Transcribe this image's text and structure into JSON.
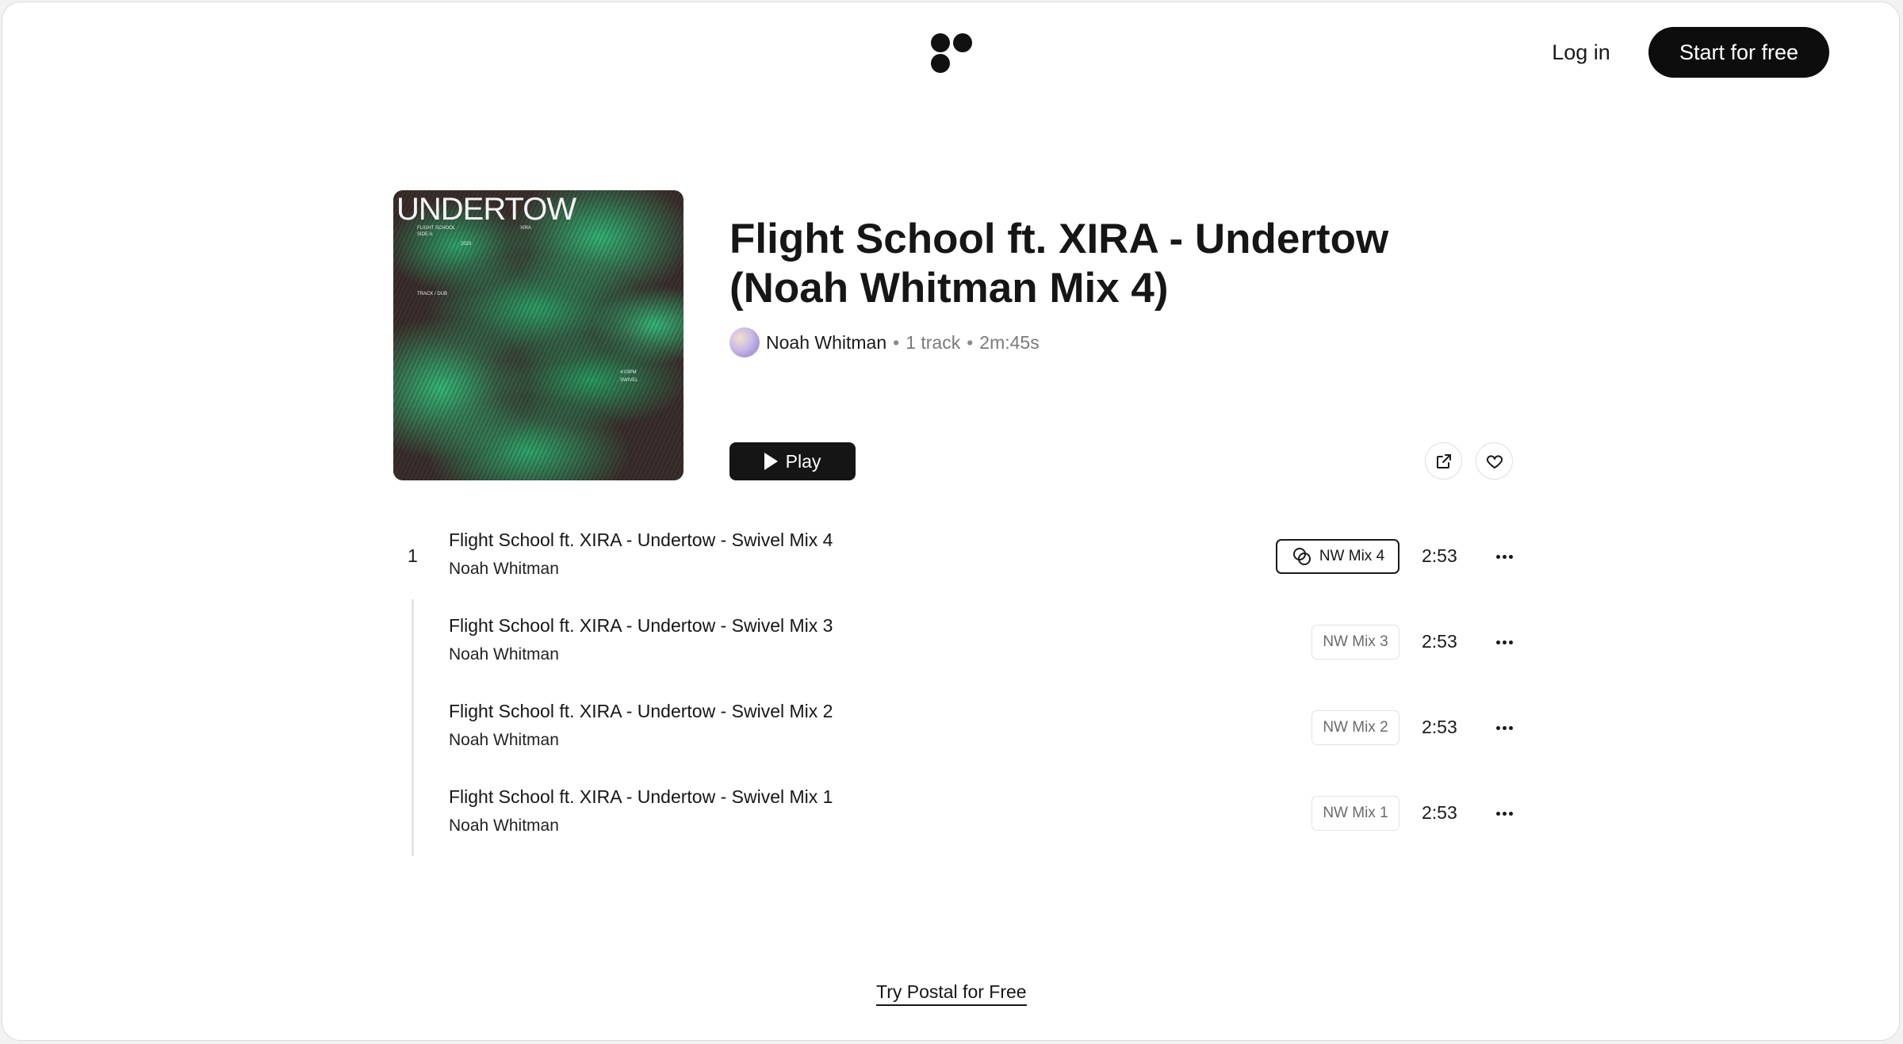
{
  "header": {
    "login_label": "Log in",
    "start_label": "Start for free",
    "logo_icon": "three-dot-logo"
  },
  "album": {
    "cover": {
      "title": "UNDERTOW",
      "small_texts": [
        "FLIGHT SCHOOL",
        "SIDE A",
        "XIRA",
        "2023",
        "TRACK / DUB",
        "4:03PM",
        "SWIVEL"
      ]
    },
    "title": "Flight School ft. XIRA - Undertow (Noah Whitman Mix 4)",
    "artist": "Noah Whitman",
    "track_count": "1 track",
    "duration": "2m:45s",
    "play_label": "Play",
    "share_icon": "external-share-icon",
    "like_icon": "heart-icon"
  },
  "tracks": [
    {
      "number": "1",
      "title": "Flight School ft. XIRA - Undertow - Swivel Mix 4",
      "artist": "Noah Whitman",
      "version": "NW Mix 4",
      "duration": "2:53",
      "active": true
    },
    {
      "number": "",
      "title": "Flight School ft. XIRA - Undertow - Swivel Mix 3",
      "artist": "Noah Whitman",
      "version": "NW Mix 3",
      "duration": "2:53",
      "active": false
    },
    {
      "number": "",
      "title": "Flight School ft. XIRA - Undertow - Swivel Mix 2",
      "artist": "Noah Whitman",
      "version": "NW Mix 2",
      "duration": "2:53",
      "active": false
    },
    {
      "number": "",
      "title": "Flight School ft. XIRA - Undertow - Swivel Mix 1",
      "artist": "Noah Whitman",
      "version": "NW Mix 1",
      "duration": "2:53",
      "active": false
    }
  ],
  "footer": {
    "cta_label": "Try Postal for Free"
  },
  "colors": {
    "accent": "#0d0d0d",
    "cover_green": "#34b374",
    "cover_dark": "#3b2f2c"
  }
}
